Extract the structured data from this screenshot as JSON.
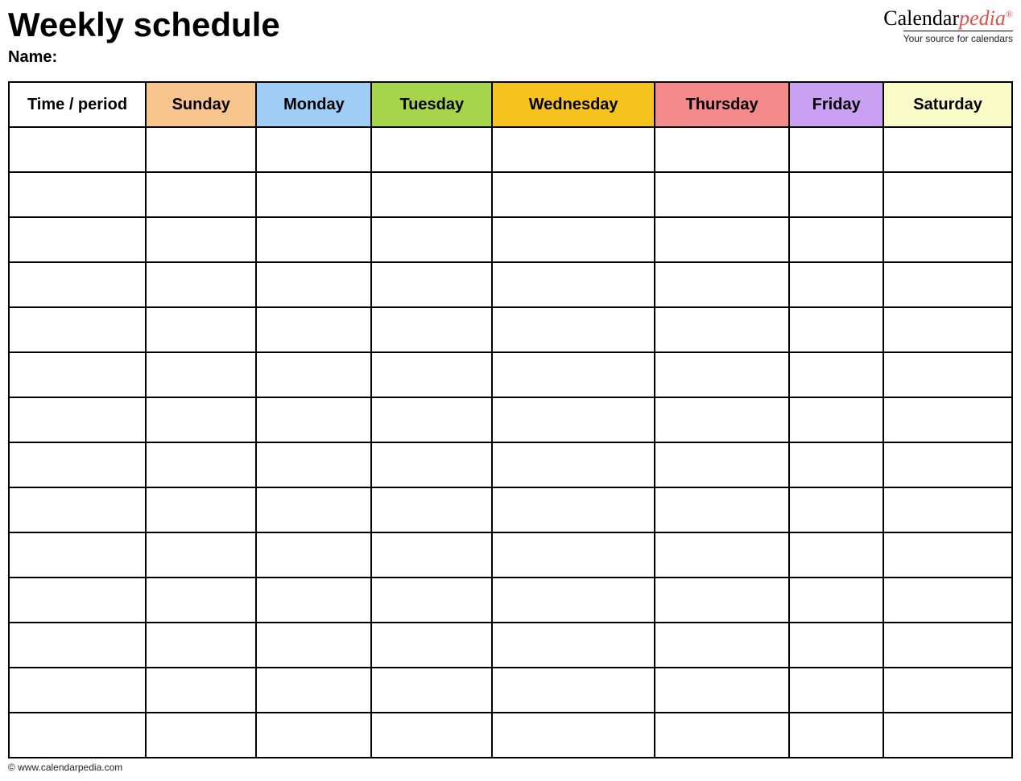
{
  "title": "Weekly schedule",
  "name_label": "Name:",
  "logo": {
    "prefix": "Calendar",
    "suffix": "pedia",
    "reg": "®",
    "tagline": "Your source for calendars"
  },
  "columns": [
    {
      "label": "Time / period",
      "color": "#ffffff"
    },
    {
      "label": "Sunday",
      "color": "#f8c58f"
    },
    {
      "label": "Monday",
      "color": "#9fcdf5"
    },
    {
      "label": "Tuesday",
      "color": "#a6d44b"
    },
    {
      "label": "Wednesday",
      "color": "#f6c21d"
    },
    {
      "label": "Thursday",
      "color": "#f48a8a"
    },
    {
      "label": "Friday",
      "color": "#caa0f2"
    },
    {
      "label": "Saturday",
      "color": "#fafcc8"
    }
  ],
  "row_count": 14,
  "footer": "© www.calendarpedia.com"
}
